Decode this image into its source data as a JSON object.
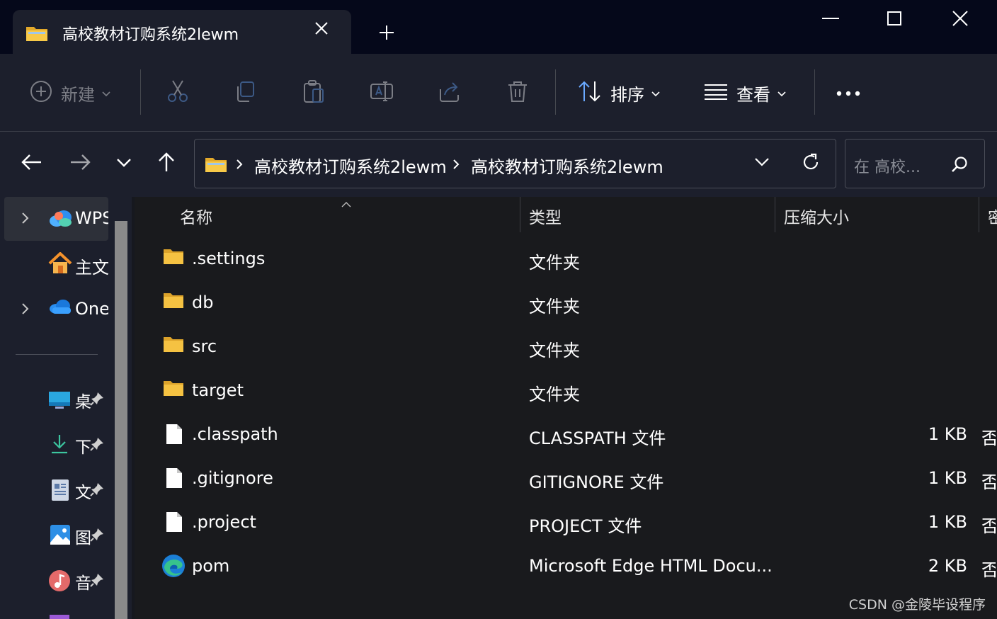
{
  "window": {
    "tab_title": "高校教材订购系统2lewm",
    "icons": {
      "folder": "folder-icon",
      "close_tab": "close-icon",
      "new_tab": "plus-icon",
      "minimize": "minimize-icon",
      "maximize": "maximize-icon",
      "close": "close-icon"
    }
  },
  "toolbar": {
    "new_label": "新建",
    "sort_label": "排序",
    "view_label": "查看",
    "icons": [
      "plus-circle-icon",
      "cut-icon",
      "copy-icon",
      "paste-icon",
      "rename-icon",
      "share-icon",
      "delete-icon",
      "sort-icon",
      "view-icon",
      "more-icon"
    ]
  },
  "address": {
    "crumbs": [
      "高校教材订购系统2lewm",
      "高校教材订购系统2lewm"
    ],
    "search_placeholder": "在 高校..."
  },
  "sidebar": {
    "items": [
      {
        "label": "WPS",
        "icon": "wps-cloud-icon",
        "expandable": true,
        "selected": true
      },
      {
        "label": "主文",
        "icon": "home-icon",
        "expandable": false,
        "selected": false
      },
      {
        "label": "One",
        "icon": "onedrive-icon",
        "expandable": true,
        "selected": false
      }
    ],
    "quick_access": [
      {
        "label": "桌",
        "icon": "desktop-icon"
      },
      {
        "label": "下",
        "icon": "download-icon"
      },
      {
        "label": "文",
        "icon": "documents-icon"
      },
      {
        "label": "图",
        "icon": "pictures-icon"
      },
      {
        "label": "音",
        "icon": "music-icon"
      }
    ]
  },
  "columns": {
    "name": "名称",
    "type": "类型",
    "size": "压缩大小",
    "extra": "密"
  },
  "files": [
    {
      "name": ".settings",
      "type": "文件夹",
      "size": "",
      "extra": "",
      "icon": "folder-icon"
    },
    {
      "name": "db",
      "type": "文件夹",
      "size": "",
      "extra": "",
      "icon": "folder-icon"
    },
    {
      "name": "src",
      "type": "文件夹",
      "size": "",
      "extra": "",
      "icon": "folder-icon"
    },
    {
      "name": "target",
      "type": "文件夹",
      "size": "",
      "extra": "",
      "icon": "folder-icon"
    },
    {
      "name": ".classpath",
      "type": "CLASSPATH 文件",
      "size": "1 KB",
      "extra": "否",
      "icon": "file-icon"
    },
    {
      "name": ".gitignore",
      "type": "GITIGNORE 文件",
      "size": "1 KB",
      "extra": "否",
      "icon": "file-icon"
    },
    {
      "name": ".project",
      "type": "PROJECT 文件",
      "size": "1 KB",
      "extra": "否",
      "icon": "file-icon"
    },
    {
      "name": "pom",
      "type": "Microsoft Edge HTML Docu...",
      "size": "2 KB",
      "extra": "否",
      "icon": "edge-icon"
    }
  ],
  "watermark": "CSDN @金陵毕设程序",
  "colors": {
    "title_bg": "#05081a",
    "panel_bg": "#1c1f2c",
    "list_bg": "#191a1d",
    "folder_yellow": "#f5c242",
    "accent_blue": "#5aa7ff"
  }
}
